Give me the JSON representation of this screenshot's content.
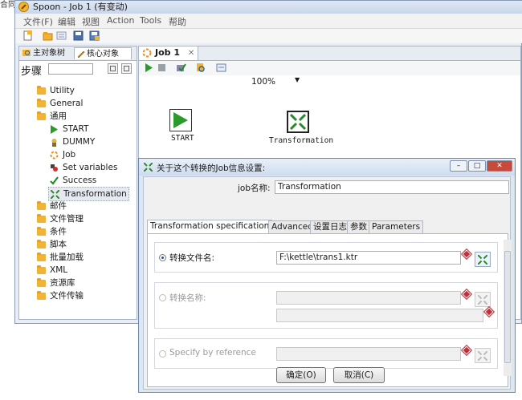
{
  "corner_text": "合同",
  "window": {
    "title": "Spoon - Job 1 (有变动)",
    "menu": [
      "文件(F)",
      "编辑",
      "视图",
      "Action",
      "Tools",
      "帮助"
    ]
  },
  "left_panel": {
    "tabs": [
      "主对象树",
      "核心对象"
    ],
    "steps_label": "步骤",
    "tree": [
      {
        "label": "Utility",
        "kind": "folder"
      },
      {
        "label": "General",
        "kind": "folder"
      },
      {
        "label": "通用",
        "kind": "folder"
      },
      {
        "label": "START",
        "kind": "start"
      },
      {
        "label": "DUMMY",
        "kind": "dummy"
      },
      {
        "label": "Job",
        "kind": "job"
      },
      {
        "label": "Set variables",
        "kind": "setvars"
      },
      {
        "label": "Success",
        "kind": "success"
      },
      {
        "label": "Transformation",
        "kind": "transformation"
      },
      {
        "label": "邮件",
        "kind": "folder"
      },
      {
        "label": "文件管理",
        "kind": "folder"
      },
      {
        "label": "条件",
        "kind": "folder"
      },
      {
        "label": "脚本",
        "kind": "folder"
      },
      {
        "label": "批量加载",
        "kind": "folder"
      },
      {
        "label": "XML",
        "kind": "folder"
      },
      {
        "label": "资源库",
        "kind": "folder"
      },
      {
        "label": "文件传输",
        "kind": "folder"
      }
    ]
  },
  "job": {
    "tab_label": "Job 1",
    "zoom": "100%",
    "canvas": {
      "start_label": "START",
      "transformation_label": "Transformation"
    }
  },
  "dialog": {
    "title": "关于这个转换的Job信息设置:",
    "job_name_label": "job名称:",
    "job_name_value": "Transformation",
    "tabs": [
      "Transformation specification",
      "Advanced",
      "设置日志",
      "参数",
      "Parameters"
    ],
    "active_tab": 0,
    "option_filename_label": "转换文件名:",
    "option_filename_value": "F:\\kettle\\trans1.ktr",
    "option_name_label": "转换名称:",
    "option_reference_label": "Specify by reference",
    "ok_label": "确定(O)",
    "cancel_label": "取消(C)"
  },
  "colors": {
    "accent_green": "#2a8a2a",
    "required_marker": "#c0303a",
    "folder": "#f2b233"
  }
}
